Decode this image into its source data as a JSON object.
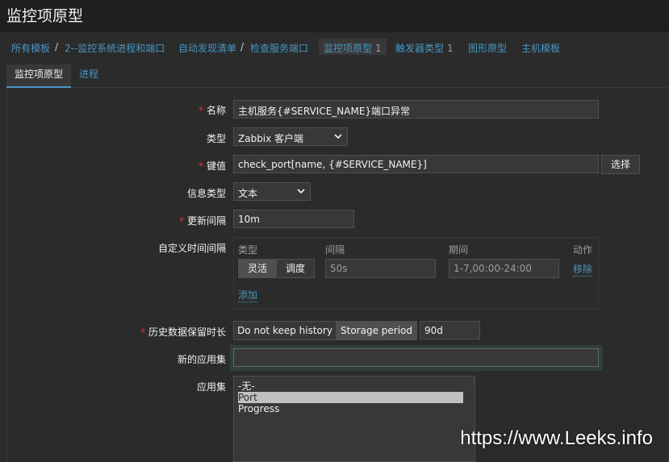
{
  "page": {
    "title": "监控项原型"
  },
  "breadcrumb": {
    "all_templates": "所有模板",
    "separator": "/",
    "template": "2--监控系统进程和端口",
    "discovery_list": "自动发现清单",
    "discovery_rule": "检查服务端口",
    "item_prototypes": "监控项原型",
    "item_prototypes_count": "1",
    "trigger_types": "触发器类型",
    "trigger_types_count": "1",
    "graph_prototypes": "图形原型",
    "host_templates": "主机模板"
  },
  "tabs": [
    {
      "label": "监控项原型",
      "active": true
    },
    {
      "label": "进程",
      "active": false
    }
  ],
  "form": {
    "required_mark": "*",
    "name": {
      "label": "名称",
      "value": "主机服务{#SERVICE_NAME}端口异常"
    },
    "type": {
      "label": "类型",
      "value": "Zabbix 客户端"
    },
    "key": {
      "label": "键值",
      "value": "check_port[name, {#SERVICE_NAME}]",
      "select_button": "选择"
    },
    "info_type": {
      "label": "信息类型",
      "value": "文本"
    },
    "update_interval": {
      "label": "更新间隔",
      "value": "10m"
    },
    "custom_intervals": {
      "label": "自定义时间间隔",
      "col_type": "类型",
      "col_interval": "间隔",
      "col_period": "期间",
      "col_action": "动作",
      "flexible": "灵活",
      "scheduling": "调度",
      "interval_placeholder": "50s",
      "period_placeholder": "1-7,00:00-24:00",
      "remove": "移除",
      "add": "添加"
    },
    "history": {
      "label": "历史数据保留时长",
      "no_keep": "Do not keep history",
      "storage_period": "Storage period",
      "value": "90d"
    },
    "new_app": {
      "label": "新的应用集",
      "value": ""
    },
    "applications": {
      "label": "应用集",
      "options": [
        "-无-",
        "Port",
        "Progress"
      ],
      "selected": "Port"
    }
  },
  "watermark": "https://www.Leeks.info",
  "colors": {
    "background": "#2b2b2b",
    "header": "#1f1f1f",
    "link": "#4796c4",
    "required": "#e33734",
    "input_bg": "#383838"
  }
}
